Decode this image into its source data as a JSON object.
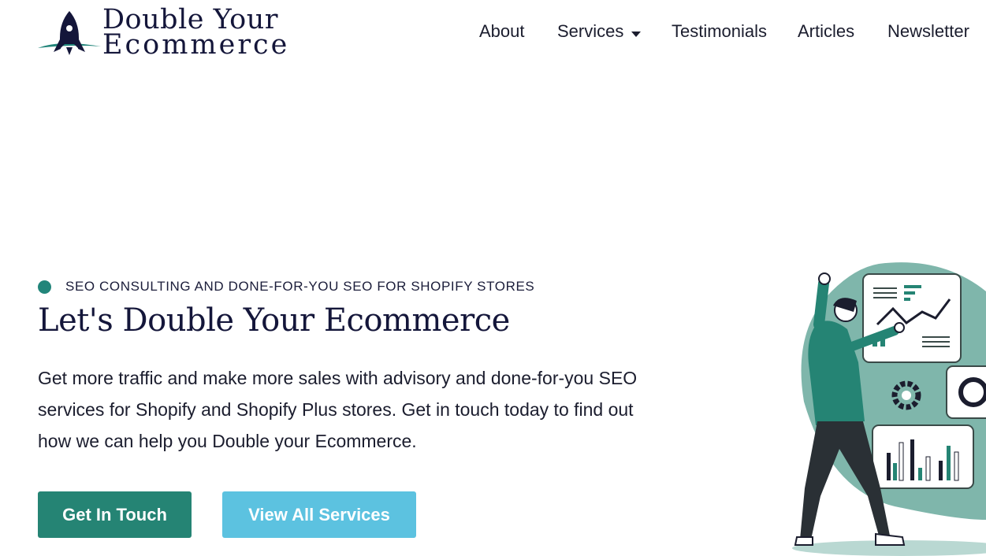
{
  "brand": {
    "line1": "Double Your",
    "line2": "Ecommerce",
    "logo_icon": "rocket-icon"
  },
  "nav": {
    "items": [
      {
        "label": "About"
      },
      {
        "label": "Services",
        "has_dropdown": true
      },
      {
        "label": "Testimonials"
      },
      {
        "label": "Articles"
      },
      {
        "label": "Newsletter"
      }
    ]
  },
  "hero": {
    "eyebrow": "SEO CONSULTING AND DONE-FOR-YOU SEO FOR SHOPIFY STORES",
    "title": "Let's Double Your Ecommerce",
    "description": "Get more traffic and make more sales with advisory and done-for-you SEO services for Shopify and Shopify Plus stores. Get in touch today to find out how we can help you Double your Ecommerce.",
    "primary_cta": "Get In Touch",
    "secondary_cta": "View All Services"
  },
  "colors": {
    "brand_navy": "#14163a",
    "accent_teal": "#258474",
    "accent_light_blue": "#5cc2e0",
    "illustration_bg": "#7fb6ab"
  }
}
